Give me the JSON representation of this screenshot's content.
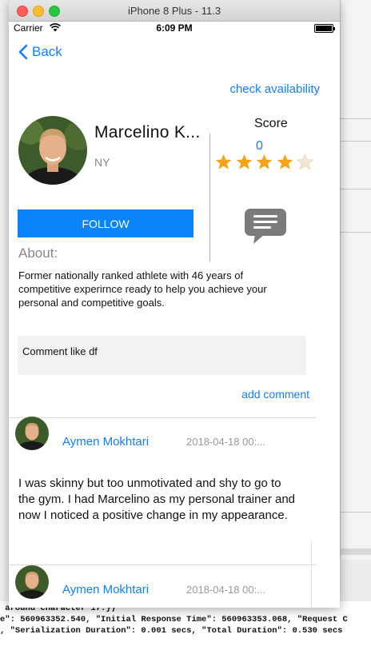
{
  "window": {
    "title": "iPhone 8 Plus - 11.3"
  },
  "status_bar": {
    "carrier": "Carrier",
    "time": "6:09 PM"
  },
  "nav": {
    "back_label": "Back"
  },
  "profile": {
    "check_availability": "check availability",
    "name": "Marcelino  K...",
    "location": "NY",
    "score_label": "Score",
    "score_value": "0",
    "rating_stars": 4,
    "rating_max": 5,
    "follow_label": "FOLLOW",
    "about_label": "About:",
    "bio": "Former nationally ranked athlete with 46 years of competitive experirnce ready to help you achieve your personal and competitive goals."
  },
  "comment_input": {
    "value": "Comment like df"
  },
  "add_comment_label": "add comment",
  "comments": [
    {
      "author": "Aymen Mokhtari",
      "date": "2018-04-18 00:...",
      "text": " I was skinny but too unmotivated and shy to go to the gym. I had Marcelino as my personal trainer and now I noticed a positive change in my appearance."
    },
    {
      "author": "Aymen Mokhtari",
      "date": "2018-04-18 00:..."
    }
  ],
  "console": {
    "line1": " around character 17.})",
    "line2": "e\": 560963352.540, \"Initial Response Time\": 560963353.068, \"Request C",
    "line3": ", \"Serialization Duration\": 0.001 secs, \"Total Duration\": 0.530 secs"
  },
  "colors": {
    "accent": "#147efb",
    "follow_bg": "#0a84f7",
    "star": "#f5a31a"
  }
}
